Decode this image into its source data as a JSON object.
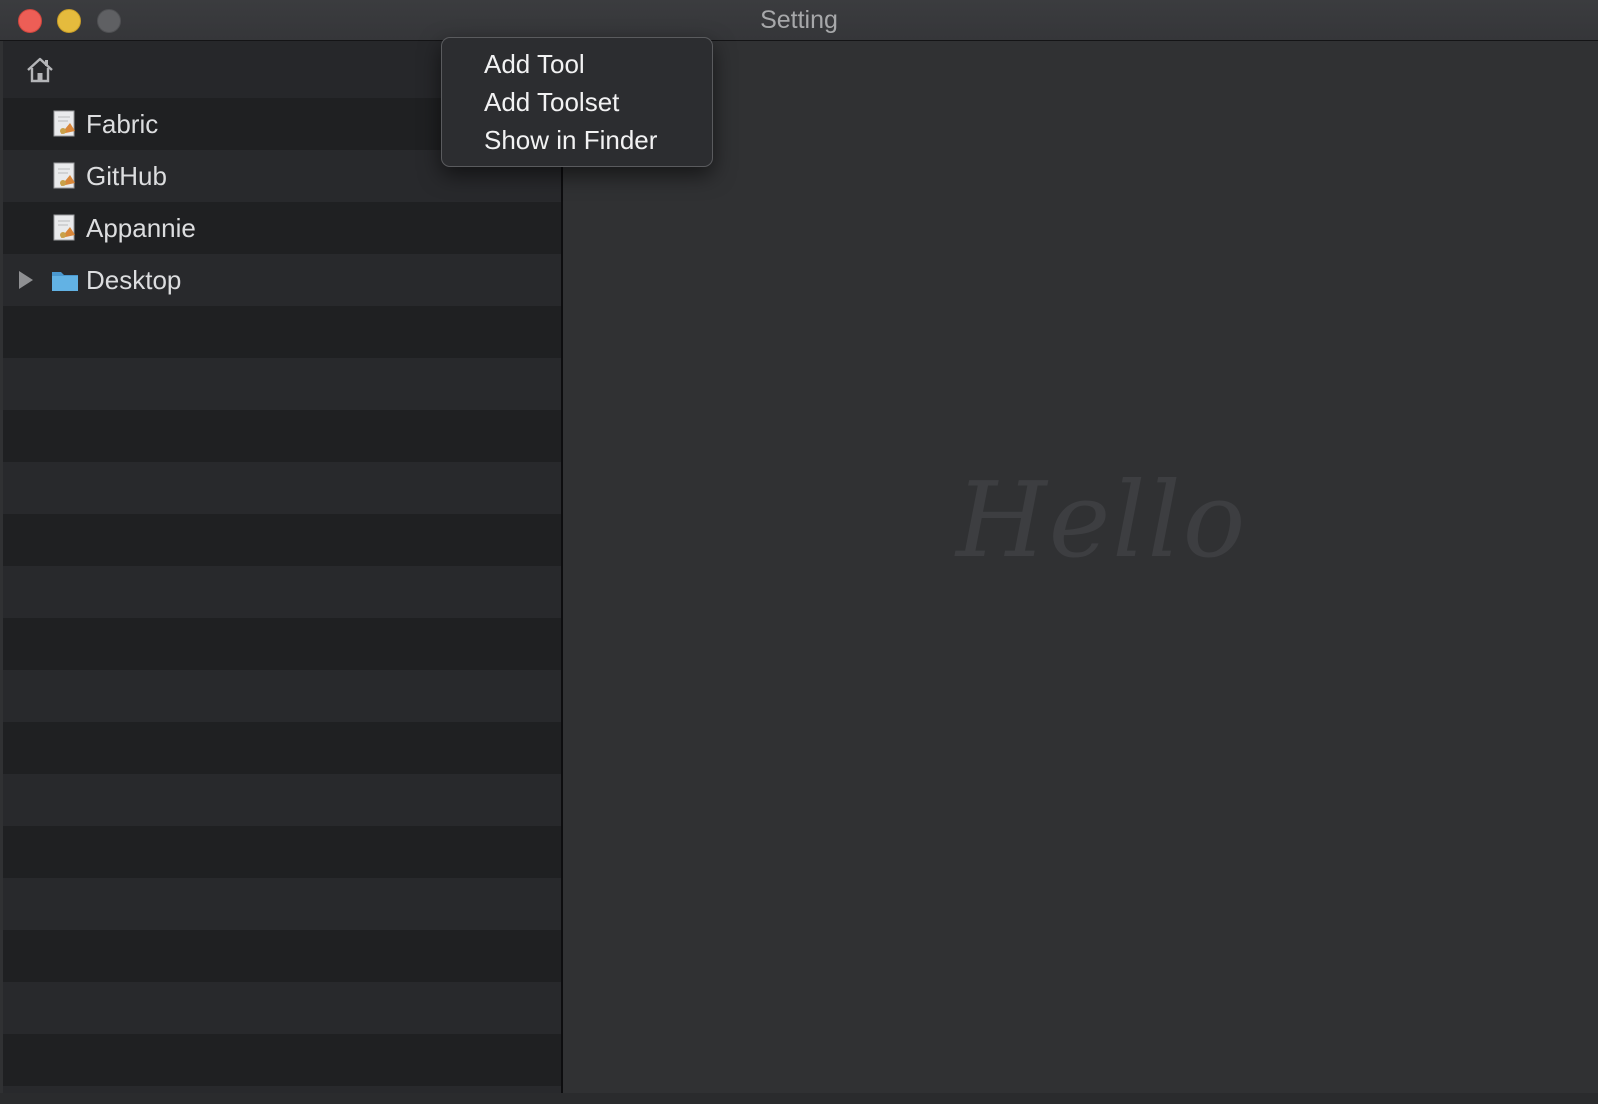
{
  "window": {
    "title": "Setting"
  },
  "sidebar": {
    "home_icon": "home-icon",
    "items": [
      {
        "label": "Fabric",
        "icon": "script-file-icon"
      },
      {
        "label": "GitHub",
        "icon": "script-file-icon"
      },
      {
        "label": "Appannie",
        "icon": "script-file-icon"
      },
      {
        "label": "Desktop",
        "icon": "folder-icon",
        "expandable": true,
        "expanded": false
      }
    ]
  },
  "context_menu": {
    "items": [
      {
        "label": "Add Tool"
      },
      {
        "label": "Add Toolset"
      },
      {
        "label": "Show in Finder"
      }
    ]
  },
  "main": {
    "watermark": "Hello"
  },
  "colors": {
    "close": "#ed5e56",
    "minimize": "#e5bb3d",
    "zoom": "#5f6063",
    "folder": "#5aa9dc"
  }
}
